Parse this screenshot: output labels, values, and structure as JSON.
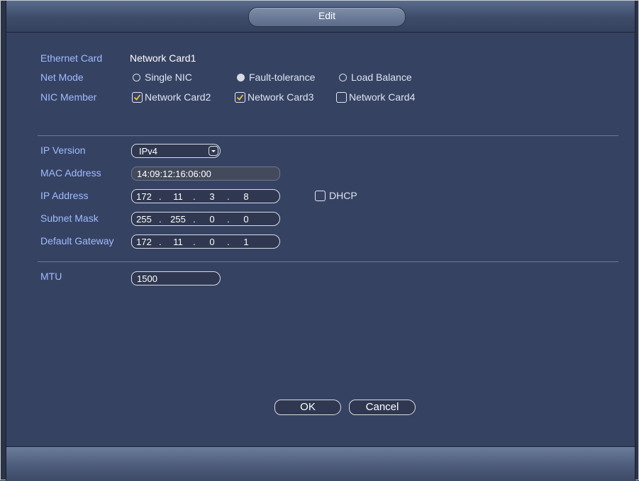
{
  "dialog": {
    "title": "Edit"
  },
  "ethernet": {
    "label": "Ethernet Card",
    "value": "Network Card1"
  },
  "net_mode": {
    "label": "Net Mode",
    "options": [
      {
        "label": "Single NIC",
        "selected": false
      },
      {
        "label": "Fault-tolerance",
        "selected": true
      },
      {
        "label": "Load Balance",
        "selected": false
      }
    ]
  },
  "nic_member": {
    "label": "NIC Member",
    "options": [
      {
        "label": "Network Card2",
        "checked": true
      },
      {
        "label": "Network Card3",
        "checked": true
      },
      {
        "label": "Network Card4",
        "checked": false
      }
    ]
  },
  "ip_version": {
    "label": "IP Version",
    "value": "IPv4"
  },
  "mac": {
    "label": "MAC Address",
    "value": "14:09:12:16:06:00"
  },
  "ip": {
    "label": "IP Address",
    "octets": [
      "172",
      "11",
      "3",
      "8"
    ]
  },
  "dhcp": {
    "label": "DHCP",
    "checked": false
  },
  "subnet": {
    "label": "Subnet Mask",
    "octets": [
      "255",
      "255",
      "0",
      "0"
    ]
  },
  "gateway": {
    "label": "Default Gateway",
    "octets": [
      "172",
      "11",
      "0",
      "1"
    ]
  },
  "mtu": {
    "label": "MTU",
    "value": "1500"
  },
  "buttons": {
    "ok": "OK",
    "cancel": "Cancel"
  },
  "colors": {
    "background": "#364262",
    "label": "#9fbcff",
    "text": "#ffffff"
  }
}
